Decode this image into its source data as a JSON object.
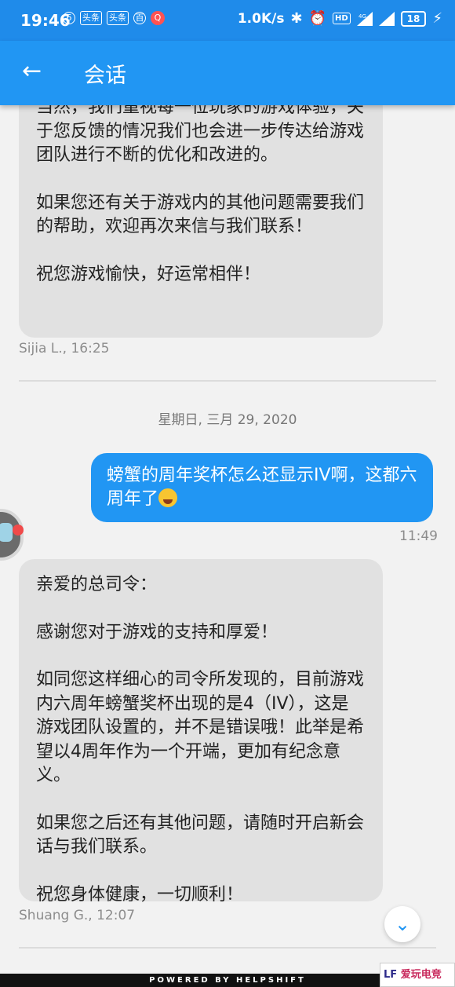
{
  "status_bar": {
    "time": "19:46",
    "left_badges": [
      "6",
      "头条",
      "头条",
      "百",
      "Q"
    ],
    "net_speed": "1.0K/s",
    "hd": "HD",
    "network": "4G",
    "battery": "18"
  },
  "app_bar": {
    "back_icon": "arrow-left-icon",
    "title": "会话"
  },
  "messages": {
    "m1": {
      "paragraphs": [
        "当然，我们重视每一位玩家的游戏体验，关于您反馈的情况我们也会进一步传达给游戏团队进行不断的优化和改进的。",
        "如果您还有关于游戏内的其他问题需要我们的帮助，欢迎再次来信与我们联系！",
        "祝您游戏愉快，好运常相伴！"
      ],
      "meta": "Sijia L., 16:25"
    },
    "date_separator": "星期日, 三月 29, 2020",
    "m2": {
      "text": "螃蟹的周年奖杯怎么还显示IV啊，这都六周年了",
      "emoji": "face-with-tears-of-joy",
      "time": "11:49"
    },
    "m3": {
      "paragraphs": [
        "亲爱的总司令：",
        "感谢您对于游戏的支持和厚爱！",
        "如同您这样细心的司令所发现的，目前游戏内六周年螃蟹奖杯出现的是4（IV），这是游戏团队设置的，并不是错误哦！此举是希望以4周年作为一个开端，更加有纪念意义。",
        "如果您之后还有其他问题，请随时开启新会话与我们联系。",
        "祝您身体健康，一切顺利！"
      ],
      "meta": "Shuang G., 12:07"
    }
  },
  "scroll_button_icon": "chevron-down-icon",
  "footer": "POWERED BY HELPSHIFT",
  "watermark": {
    "logo": "LF",
    "text": "爱玩电竞"
  },
  "colors": {
    "primary": "#2196f3",
    "status_bar": "#1f8bea",
    "incoming_bubble": "#e1e1e1",
    "background": "#f2f2f2"
  }
}
